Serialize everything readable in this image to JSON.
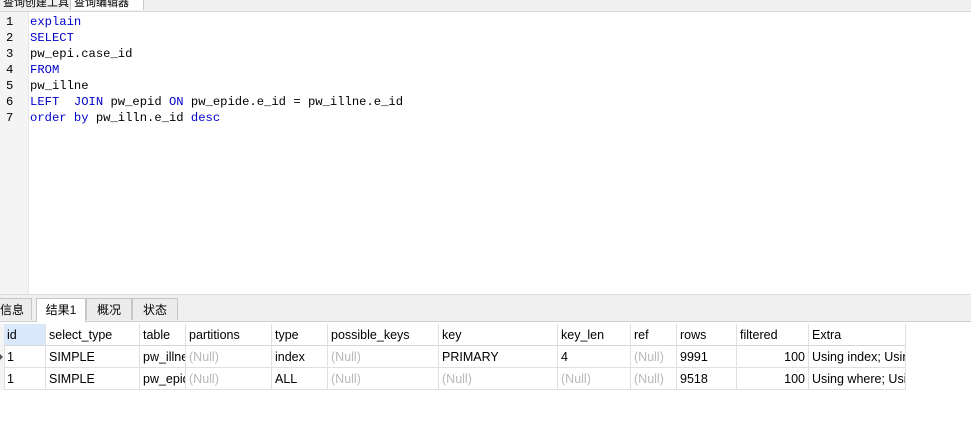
{
  "top_tabs": [
    "查询创建工具",
    "查询编辑器"
  ],
  "editor": {
    "lines": [
      {
        "num": "1",
        "tokens": [
          {
            "t": "explain",
            "kw": true
          }
        ]
      },
      {
        "num": "2",
        "tokens": [
          {
            "t": "SELECT",
            "kw": true
          }
        ]
      },
      {
        "num": "3",
        "tokens": [
          {
            "t": "pw_epi.case_id",
            "kw": false
          }
        ]
      },
      {
        "num": "4",
        "tokens": [
          {
            "t": "FROM",
            "kw": true
          }
        ]
      },
      {
        "num": "5",
        "tokens": [
          {
            "t": "pw_illne",
            "kw": false
          }
        ]
      },
      {
        "num": "6",
        "tokens": [
          {
            "t": "LEFT  JOIN",
            "kw": true
          },
          {
            "t": " pw_epid ",
            "kw": false
          },
          {
            "t": "ON",
            "kw": true
          },
          {
            "t": " pw_epide.e_id = pw_illne.e_id",
            "kw": false
          }
        ]
      },
      {
        "num": "7",
        "tokens": [
          {
            "t": "order by",
            "kw": true
          },
          {
            "t": " pw_illn.e_id ",
            "kw": false
          },
          {
            "t": "desc",
            "kw": true
          }
        ]
      }
    ]
  },
  "panel_tabs": {
    "info": "信息",
    "result1": "结果1",
    "profile": "概况",
    "status": "状态"
  },
  "result": {
    "headers": [
      "id",
      "select_type",
      "table",
      "partitions",
      "type",
      "possible_keys",
      "key",
      "key_len",
      "ref",
      "rows",
      "filtered",
      "Extra"
    ],
    "rows": [
      [
        "1",
        "SIMPLE",
        "pw_illne",
        "(Null)",
        "index",
        "(Null)",
        "PRIMARY",
        "4",
        "(Null)",
        "9991",
        "100",
        "Using index; Using temporary; Using filesort"
      ],
      [
        "1",
        "SIMPLE",
        "pw_epid",
        "(Null)",
        "ALL",
        "(Null)",
        "(Null)",
        "(Null)",
        "(Null)",
        "9518",
        "100",
        "Using where; Using join buffer"
      ]
    ]
  },
  "colors": {
    "keyword": "#0000cc",
    "null_text": "#b9b9b9",
    "selected_header": "#d9e8fb"
  }
}
